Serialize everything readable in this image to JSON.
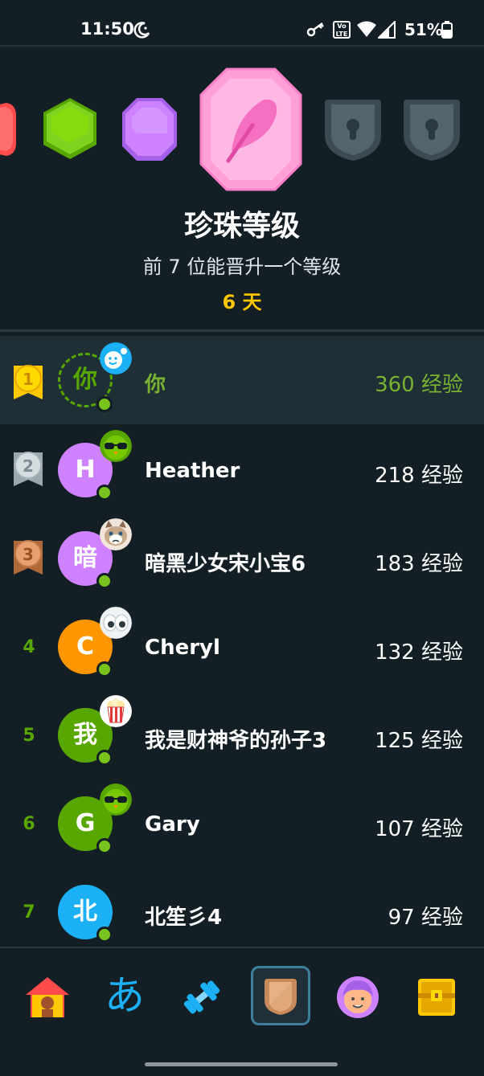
{
  "status_bar": {
    "time": "11:50",
    "volte": "Vo LTE",
    "battery": "51%"
  },
  "league": {
    "title": "珍珠等级",
    "subtitle": "前 7 位能晋升一个等级",
    "days_left": "6 天",
    "badges": [
      "ruby-partial",
      "emerald",
      "amethyst",
      "pearl-current",
      "locked",
      "locked"
    ]
  },
  "leaderboard": [
    {
      "rank": "1",
      "avatar_text": "你",
      "name": "你",
      "xp": "360 经验",
      "is_me": true,
      "avatar_color": "",
      "decoration": "gear-smiley"
    },
    {
      "rank": "2",
      "avatar_text": "H",
      "name": "Heather",
      "xp": "218 经验",
      "is_me": false,
      "avatar_color": "#ce82ff",
      "decoration": "sunglasses-owl"
    },
    {
      "rank": "3",
      "avatar_text": "暗",
      "name": "暗黑少女宋小宝6",
      "xp": "183 经验",
      "is_me": false,
      "avatar_color": "#ce82ff",
      "decoration": "grumpy-cat"
    },
    {
      "rank": "4",
      "avatar_text": "C",
      "name": "Cheryl",
      "xp": "132 经验",
      "is_me": false,
      "avatar_color": "#ff9600",
      "decoration": "googly-eyes"
    },
    {
      "rank": "5",
      "avatar_text": "我",
      "name": "我是财神爷的孙子3",
      "xp": "125 经验",
      "is_me": false,
      "avatar_color": "#58a700",
      "decoration": "popcorn"
    },
    {
      "rank": "6",
      "avatar_text": "G",
      "name": "Gary",
      "xp": "107 经验",
      "is_me": false,
      "avatar_color": "#58a700",
      "decoration": "sunglasses-owl"
    },
    {
      "rank": "7",
      "avatar_text": "北",
      "name": "北笙彡4",
      "xp": "97 经验",
      "is_me": false,
      "avatar_color": "#1cb0f6",
      "decoration": ""
    }
  ],
  "tabbar": {
    "home_label": "home-icon",
    "characters_glyph": "あ",
    "practice_label": "dumbbell-icon",
    "leagues_label": "league-shield-icon",
    "profile_label": "profile-avatar-icon",
    "shop_label": "treasure-chest-icon",
    "active": "leagues"
  },
  "colors": {
    "background": "#131f24",
    "accent_green": "#58a700",
    "gold": "#ffc800"
  }
}
